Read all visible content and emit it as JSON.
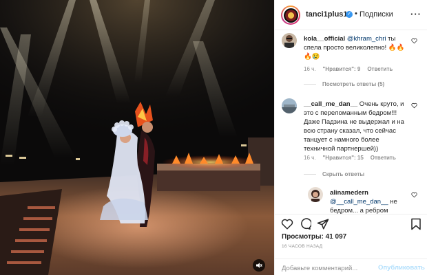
{
  "header": {
    "username": "tanci1plus1",
    "follow_label": "Подписки",
    "separator": "•"
  },
  "comments": [
    {
      "username": "kola__official",
      "mention": "@khram_chri",
      "text": " ты спела просто великолепно! 🔥🔥🔥😢",
      "time": "16 ч.",
      "likes": "\"Нравится\": 9",
      "reply": "Ответить",
      "replies_toggle": "Посмотреть ответы (5)"
    },
    {
      "username": "__call_me_dan__",
      "text": " Очень круто, и это с переломанным бедром!!! Даже Падзина не выдержал и на всю страну сказал, что сейчас танцует с намного более техничной партнершей))",
      "time": "16 ч.",
      "likes": "\"Нравится\": 15",
      "reply": "Ответить",
      "replies_toggle": "Скрыть ответы"
    },
    {
      "username": "alinamedern",
      "mention": "@__call_me_dan__",
      "text": " не бедром... а ребром"
    }
  ],
  "stats": {
    "views_label": "Просмотры:",
    "views_value": "41 097",
    "posted": "16 ЧАСОВ НАЗАД"
  },
  "comment_box": {
    "placeholder": "Добавьте комментарий...",
    "publish_label": "Опубликовать"
  },
  "colors": {
    "accent_blue": "#3897f0",
    "muted": "#8e8e8e",
    "publish_disabled": "#b2dffc",
    "stage_fire": "#ff5a1f"
  },
  "icons": [
    "mute-icon",
    "heart-icon",
    "comment-icon",
    "share-icon",
    "bookmark-icon",
    "more-icon",
    "verified-icon"
  ]
}
